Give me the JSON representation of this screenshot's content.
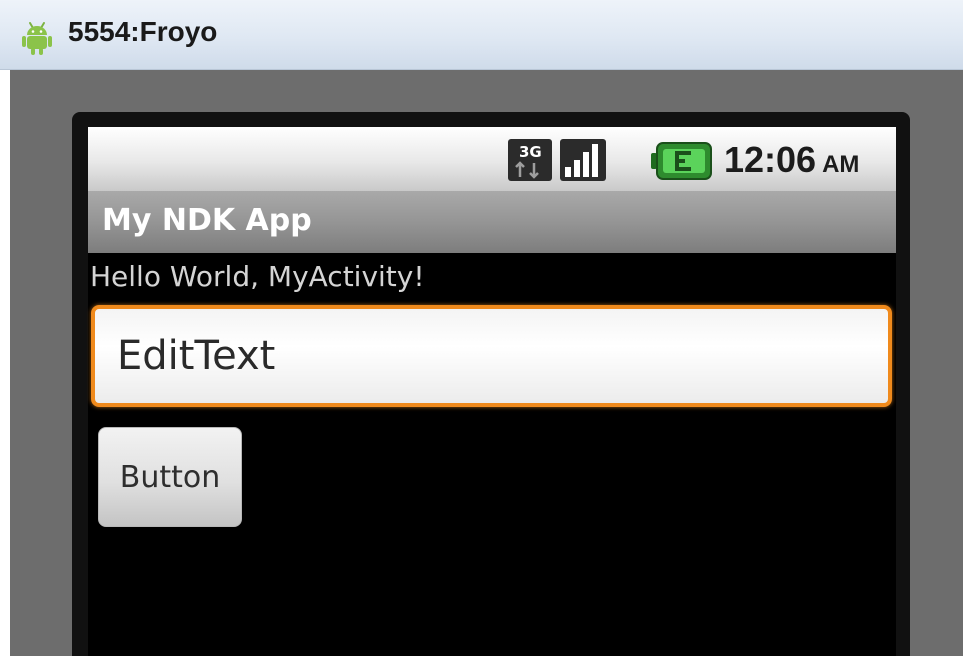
{
  "window": {
    "title": "5554:Froyo",
    "icon": "android-icon"
  },
  "statusbar": {
    "network_icon": "3g-icon",
    "network_label": "3G",
    "signal_icon": "signal-strength-icon",
    "battery_icon": "battery-charging-icon",
    "time": "12:06",
    "ampm": "AM"
  },
  "app": {
    "title": "My NDK App",
    "hello_text": "Hello World, MyActivity!",
    "edittext_value": "EditText",
    "button_label": "Button"
  },
  "colors": {
    "focus_accent": "#f08a1c",
    "screen_background": "#000000",
    "app_title_bar": "#959595"
  }
}
